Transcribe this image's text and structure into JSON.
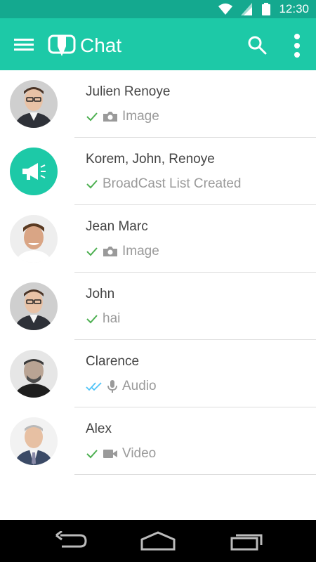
{
  "status_bar": {
    "time": "12:30"
  },
  "app_bar": {
    "title": "Chat"
  },
  "colors": {
    "primary": "#1dc9a7",
    "status_bar": "#14a98f",
    "check": "#4caf50",
    "double_check": "#4fc3f7"
  },
  "chats": [
    {
      "name": "Julien Renoye",
      "status": "sent",
      "media_icon": "camera-icon",
      "message": "Image"
    },
    {
      "name": "Korem, John, Renoye",
      "status": "sent",
      "media_icon": "",
      "message": "BroadCast List Created"
    },
    {
      "name": "Jean Marc",
      "status": "sent",
      "media_icon": "camera-icon",
      "message": "Image"
    },
    {
      "name": "John",
      "status": "sent",
      "media_icon": "",
      "message": "hai"
    },
    {
      "name": "Clarence",
      "status": "read",
      "media_icon": "microphone-icon",
      "message": "Audio"
    },
    {
      "name": "Alex",
      "status": "sent",
      "media_icon": "video-icon",
      "message": "Video"
    }
  ]
}
